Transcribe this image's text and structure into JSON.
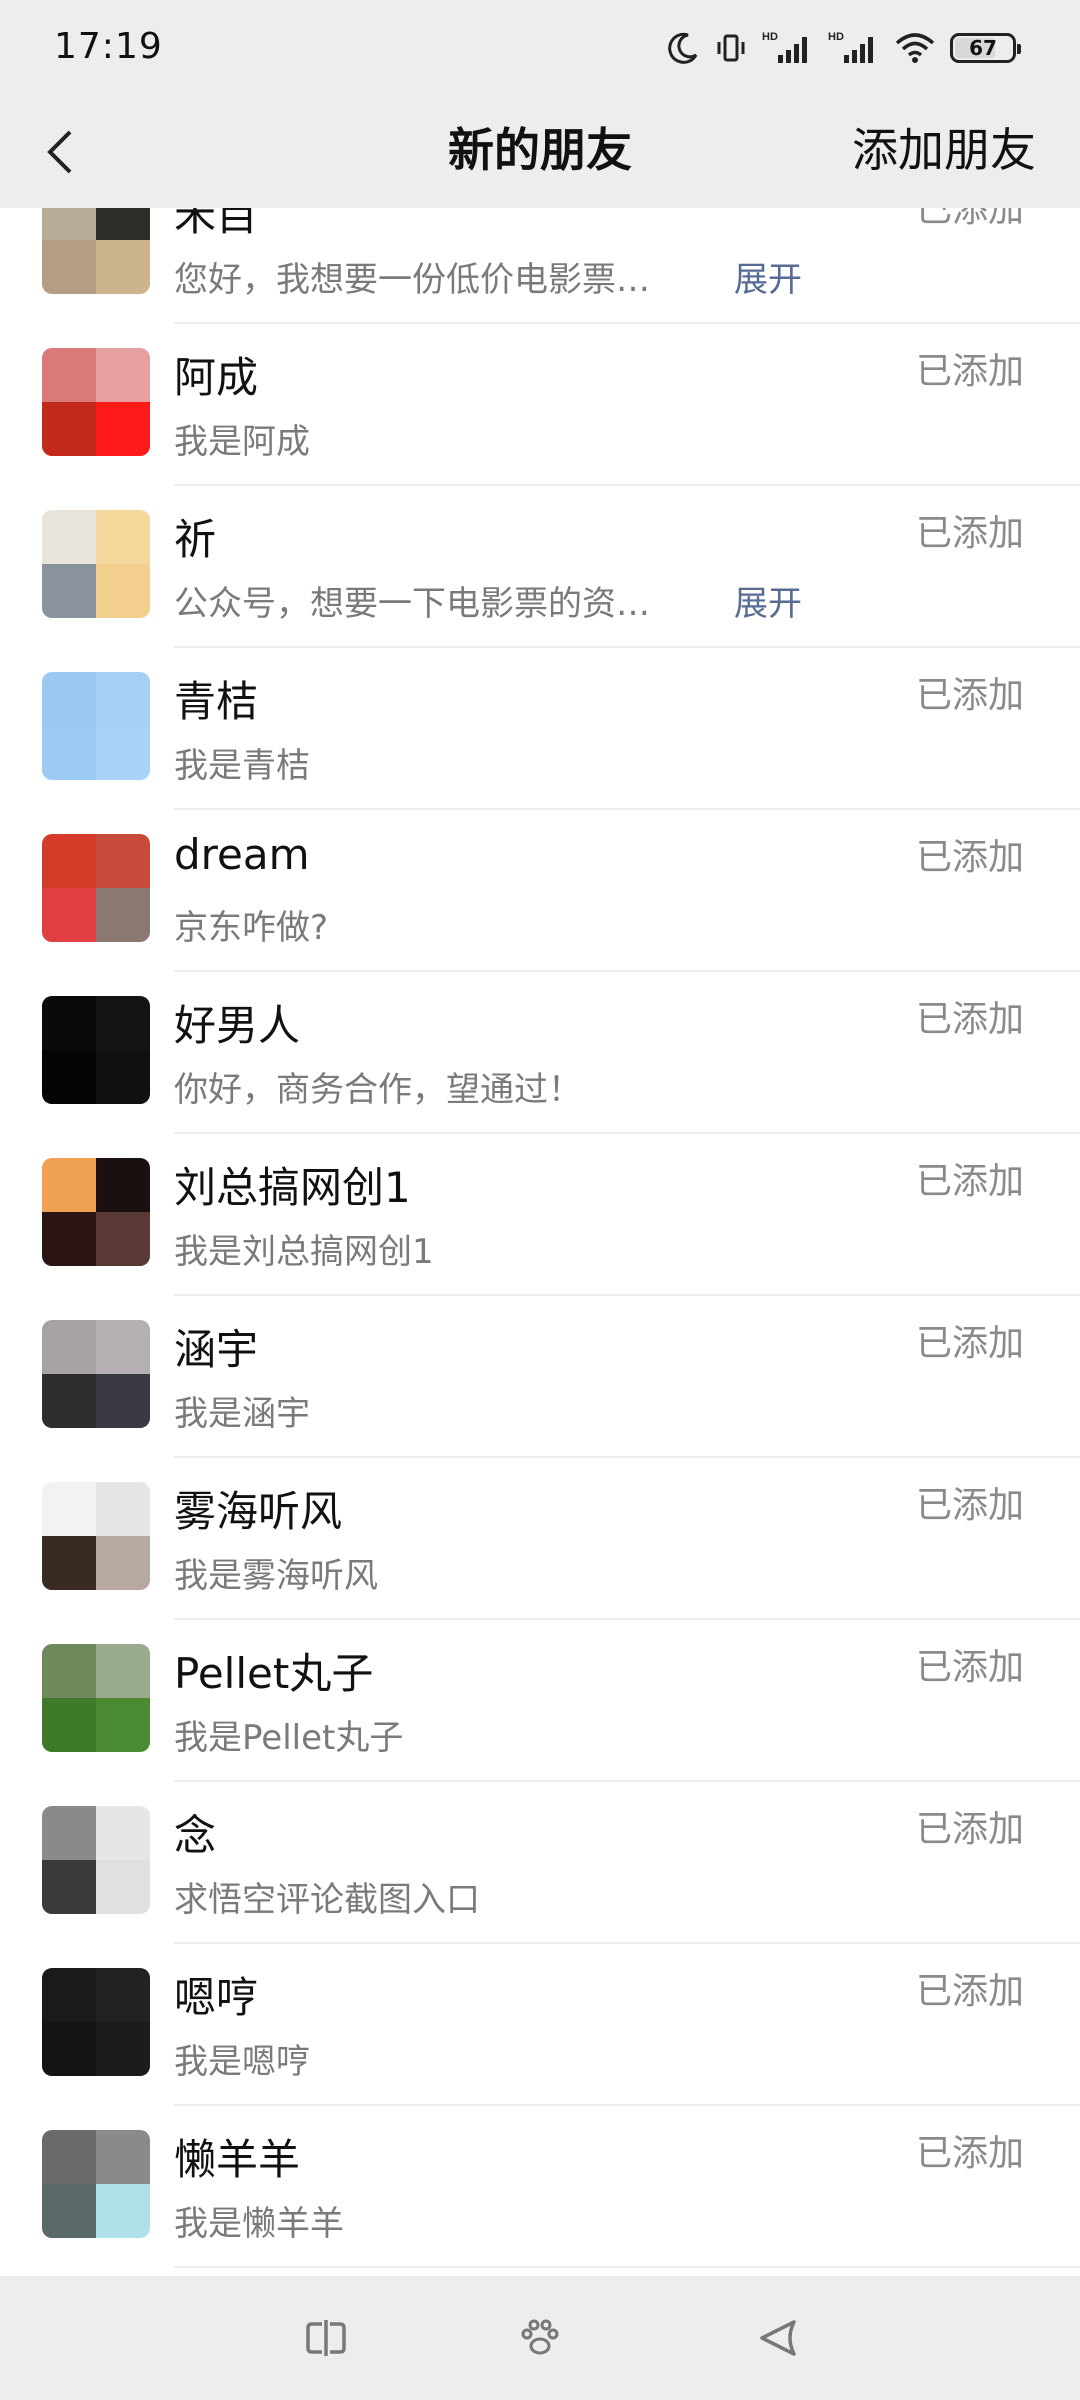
{
  "status_bar": {
    "time": "17:19",
    "battery_level": "67",
    "network_label_1": "HD",
    "network_label_2": "HD"
  },
  "nav": {
    "title": "新的朋友",
    "action": "添加朋友"
  },
  "requests": [
    {
      "name": "禾目",
      "message": "您好，我想要一份低价电影票…",
      "expand": "展开",
      "status": "已添加",
      "avatar_colors": [
        "#b8aa98",
        "#2e2e28",
        "#b49d82",
        "#cbb48e"
      ]
    },
    {
      "name": "阿成",
      "message": "我是阿成",
      "expand": "",
      "status": "已添加",
      "avatar_colors": [
        "#d87a7a",
        "#e7a0a0",
        "#c42a1a",
        "#ff1a1a"
      ]
    },
    {
      "name": "祈",
      "message": "公众号，想要一下电影票的资…",
      "expand": "展开",
      "status": "已添加",
      "avatar_colors": [
        "#e8e4dc",
        "#f4d79a",
        "#8a939c",
        "#f3cf8e"
      ]
    },
    {
      "name": "青桔",
      "message": "我是青桔",
      "expand": "",
      "status": "已添加",
      "avatar_colors": [
        "#9bc8f2",
        "#a6d0f5",
        "#9dcaf3",
        "#a8d2f6"
      ]
    },
    {
      "name": "dream",
      "message": "京东咋做?",
      "expand": "",
      "status": "已添加",
      "avatar_colors": [
        "#d63b2a",
        "#c84a3a",
        "#e24040",
        "#8a7872"
      ]
    },
    {
      "name": "好男人",
      "message": "你好，商务合作，望通过！",
      "expand": "",
      "status": "已添加",
      "avatar_colors": [
        "#0a0a0a",
        "#141414",
        "#050505",
        "#101010"
      ]
    },
    {
      "name": "刘总搞网创1",
      "message": "我是刘总搞网创1",
      "expand": "",
      "status": "已添加",
      "avatar_colors": [
        "#f0a052",
        "#1a1010",
        "#2a1414",
        "#5a3a34"
      ]
    },
    {
      "name": "涵宇",
      "message": "我是涵宇",
      "expand": "",
      "status": "已添加",
      "avatar_colors": [
        "#a6a2a6",
        "#b4b0b2",
        "#2e2e30",
        "#3a3a42"
      ]
    },
    {
      "name": "雾海听风",
      "message": "我是雾海听风",
      "expand": "",
      "status": "已添加",
      "avatar_colors": [
        "#f2f2f2",
        "#e8e6e4",
        "#3a2a24",
        "#b8a8a2"
      ]
    },
    {
      "name": "Pellet丸子",
      "message": "我是Pellet丸子",
      "expand": "",
      "status": "已添加",
      "avatar_colors": [
        "#6e8a5c",
        "#9aaa8c",
        "#3e7a2a",
        "#4a8a32"
      ]
    },
    {
      "name": "念",
      "message": "求悟空评论截图入口",
      "expand": "",
      "status": "已添加",
      "avatar_colors": [
        "#8a8a8a",
        "#e6e6e6",
        "#3a3a3a",
        "#e0e0e0"
      ]
    },
    {
      "name": "嗯哼",
      "message": "我是嗯哼",
      "expand": "",
      "status": "已添加",
      "avatar_colors": [
        "#1a1a1a",
        "#222222",
        "#141414",
        "#1c1c1c"
      ]
    },
    {
      "name": "懒羊羊",
      "message": "我是懒羊羊",
      "expand": "",
      "status": "已添加",
      "avatar_colors": [
        "#6a6a6a",
        "#8a8a8a",
        "#5a6a68",
        "#aee0ea"
      ]
    }
  ],
  "system_nav": {
    "recents_icon": "recents-icon",
    "home_icon": "home-paw-icon",
    "back_icon": "back-triangle-icon"
  }
}
